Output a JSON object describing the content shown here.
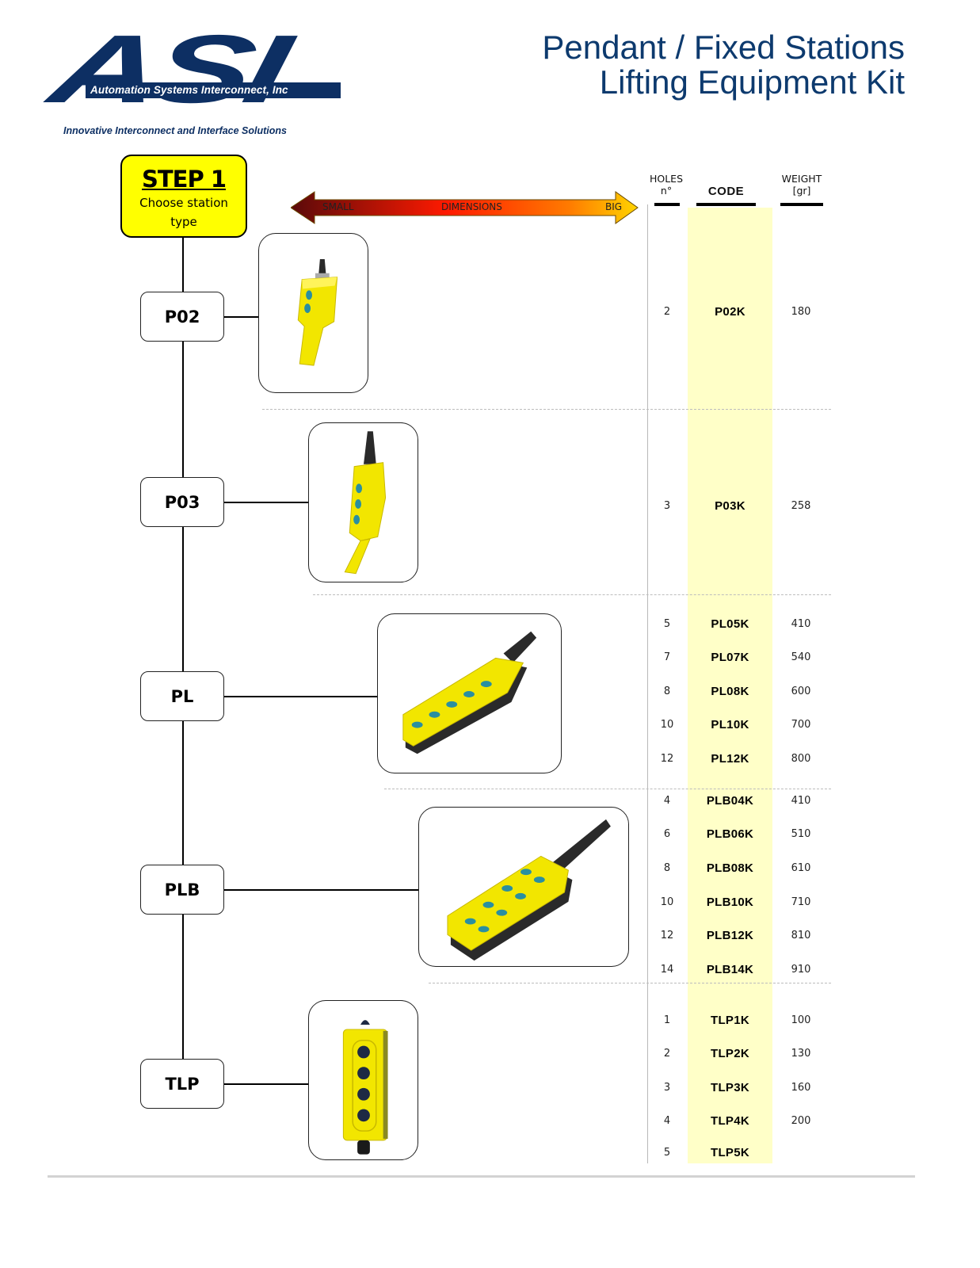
{
  "logo": {
    "letters": "ASI",
    "company": "Automation Systems Interconnect, Inc",
    "tagline": "Innovative Interconnect and Interface Solutions",
    "brand_color": "#0d2f63"
  },
  "title": {
    "line1": "Pendant / Fixed Stations",
    "line2": "Lifting Equipment Kit",
    "color": "#0d3a6e"
  },
  "step": {
    "title": "STEP 1",
    "subtitle_line1": "Choose station",
    "subtitle_line2": "type",
    "color": "#ffff00"
  },
  "dimension_arrow": {
    "left_label": "SMALL",
    "center_label": "DIMENSIONS",
    "right_label": "BIG"
  },
  "table": {
    "headers": {
      "holes_line1": "HOLES",
      "holes_line2": "n°",
      "code": "CODE",
      "weight_line1": "WEIGHT",
      "weight_line2": "[gr]"
    },
    "highlight_color": "#ffffc8"
  },
  "station_types": [
    {
      "name": "P02",
      "image": "pendant-2-button-icon",
      "rows": [
        {
          "holes": "2",
          "code": "P02K",
          "weight": "180"
        }
      ]
    },
    {
      "name": "P03",
      "image": "pendant-3-button-icon",
      "rows": [
        {
          "holes": "3",
          "code": "P03K",
          "weight": "258"
        }
      ]
    },
    {
      "name": "PL",
      "image": "pendant-pl-icon",
      "rows": [
        {
          "holes": "5",
          "code": "PL05K",
          "weight": "410"
        },
        {
          "holes": "7",
          "code": "PL07K",
          "weight": "540"
        },
        {
          "holes": "8",
          "code": "PL08K",
          "weight": "600"
        },
        {
          "holes": "10",
          "code": "PL10K",
          "weight": "700"
        },
        {
          "holes": "12",
          "code": "PL12K",
          "weight": "800"
        }
      ]
    },
    {
      "name": "PLB",
      "image": "pendant-plb-icon",
      "rows": [
        {
          "holes": "4",
          "code": "PLB04K",
          "weight": "410"
        },
        {
          "holes": "6",
          "code": "PLB06K",
          "weight": "510"
        },
        {
          "holes": "8",
          "code": "PLB08K",
          "weight": "610"
        },
        {
          "holes": "10",
          "code": "PLB10K",
          "weight": "710"
        },
        {
          "holes": "12",
          "code": "PLB12K",
          "weight": "810"
        },
        {
          "holes": "14",
          "code": "PLB14K",
          "weight": "910"
        }
      ]
    },
    {
      "name": "TLP",
      "image": "fixed-station-tlp-icon",
      "rows": [
        {
          "holes": "1",
          "code": "TLP1K",
          "weight": "100"
        },
        {
          "holes": "2",
          "code": "TLP2K",
          "weight": "130"
        },
        {
          "holes": "3",
          "code": "TLP3K",
          "weight": "160"
        },
        {
          "holes": "4",
          "code": "TLP4K",
          "weight": "200"
        },
        {
          "holes": "5",
          "code": "TLP5K",
          "weight": ""
        }
      ]
    }
  ]
}
